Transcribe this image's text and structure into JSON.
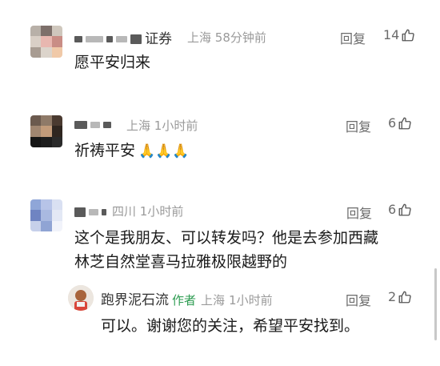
{
  "comments": [
    {
      "name_suffix": "证券",
      "location": "上海",
      "time": "58分钟前",
      "reply_label": "回复",
      "likes": "14",
      "content": "愿平安归来",
      "avatar_colors": [
        "#b8b0a8",
        "#7d6f6a",
        "#cfc7bd",
        "#d9cfc6",
        "#e8b7b0",
        "#c98d85",
        "#a89c92",
        "#dcd4cb",
        "#f0c9a8"
      ]
    },
    {
      "name_suffix": "",
      "location": "上海",
      "time": "1小时前",
      "reply_label": "回复",
      "likes": "6",
      "content": "祈祷平安",
      "emoji": "🙏🙏🙏",
      "avatar_colors": [
        "#6b5a4e",
        "#8f7a68",
        "#4a3a30",
        "#a08670",
        "#c29b7a",
        "#2f2620",
        "#151515",
        "#1d1d1d",
        "#2a2a2a"
      ]
    },
    {
      "name_suffix": "",
      "location": "四川",
      "time": "1小时前",
      "reply_label": "回复",
      "likes": "6",
      "content_line1": "这个是我朋友、可以转发吗？他是去参加西藏",
      "content_line2": "林芝自然堂喜马拉雅极限越野的",
      "avatar_colors": [
        "#8fa6d8",
        "#b7c4e8",
        "#d9e0f2",
        "#6f84c2",
        "#a9b9e0",
        "#e3e8f5",
        "#c6d0ea",
        "#90a4d4",
        "#f1f3fa"
      ]
    }
  ],
  "reply": {
    "name": "跑界泥石流",
    "author_tag": "作者",
    "location": "上海",
    "time": "1小时前",
    "reply_label": "回复",
    "likes": "2",
    "content": "可以。谢谢您的关注，希望平安找到。"
  },
  "colors": {
    "author_tag": "#2e9c52",
    "meta": "#9a9a9a",
    "text": "#1a1a1a"
  }
}
